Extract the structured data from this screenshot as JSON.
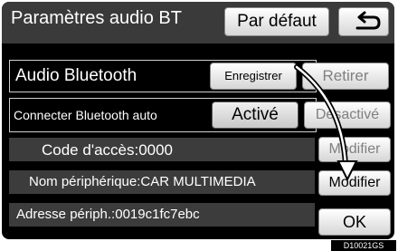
{
  "header": {
    "title": "Paramètres audio BT",
    "default_label": "Par défaut",
    "back_icon": "back-arrow-icon"
  },
  "audio_bluetooth": {
    "label": "Audio Bluetooth",
    "register_label": "Enregistrer",
    "remove_label": "Retirer"
  },
  "auto_connect": {
    "label": "Connecter Bluetooth auto",
    "on_label": "Activé",
    "off_label": "Désactivé"
  },
  "passcode": {
    "label": "Code d'accès:0000",
    "modify_label": "Modifier"
  },
  "device_name": {
    "label": "Nom périphérique:CAR MULTIMEDIA",
    "modify_label": "Modifier"
  },
  "device_address": {
    "label": "Adresse périph.:0019c1fc7ebc"
  },
  "ok_label": "OK",
  "figure_code": "D10021GS",
  "colors": {
    "screen_bg": "#000000",
    "header_bg": "#3a3a3a",
    "info_bg": "#3c3c3c",
    "button_face": "#e8e8e8"
  }
}
